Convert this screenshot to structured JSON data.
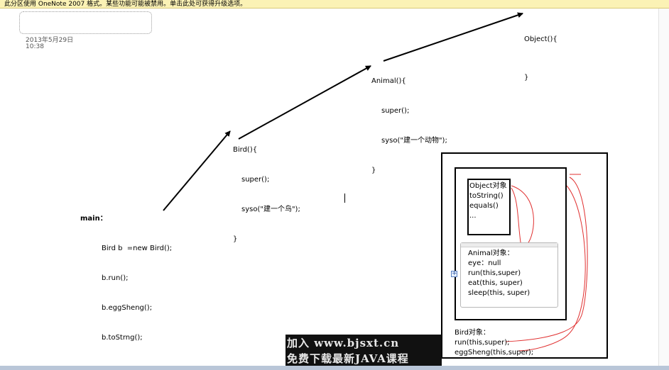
{
  "notice": "此分区使用 OneNote 2007 格式。某些功能可能被禁用。单击此处可获得升级选项。",
  "page": {
    "date": "2013年5月29日",
    "time": "10:38"
  },
  "main_code": [
    "main：",
    "Bird b  =new Bird();",
    "b.run();",
    "b.eggSheng();",
    "b.toStrng();"
  ],
  "bird_code": [
    "Bird(){",
    "super();",
    "syso(\"建一个鸟\");",
    "}"
  ],
  "animal_code": [
    "Animal(){",
    "super();",
    "syso(\"建一个动物\");",
    "}"
  ],
  "object_code": [
    "Object(){",
    "}"
  ],
  "object_box": [
    "Object对象",
    "toString()",
    "equals()",
    "..."
  ],
  "animal_box": [
    "Animal对象：",
    "eye：null",
    "run(this,super)",
    "eat(this, super)",
    "sleep(this,  super)"
  ],
  "bird_box": [
    "Bird对象：",
    "run(this,super);",
    "eggSheng(this,super);"
  ],
  "banner": {
    "line1": "加入 www.bjsxt.cn",
    "line2": "免费下载最新JAVA课程"
  },
  "colors": {
    "notice_bg": "#fbf2b5",
    "ink": "#000000",
    "annotation_red": "#e03030",
    "banner_bg": "#111111"
  }
}
